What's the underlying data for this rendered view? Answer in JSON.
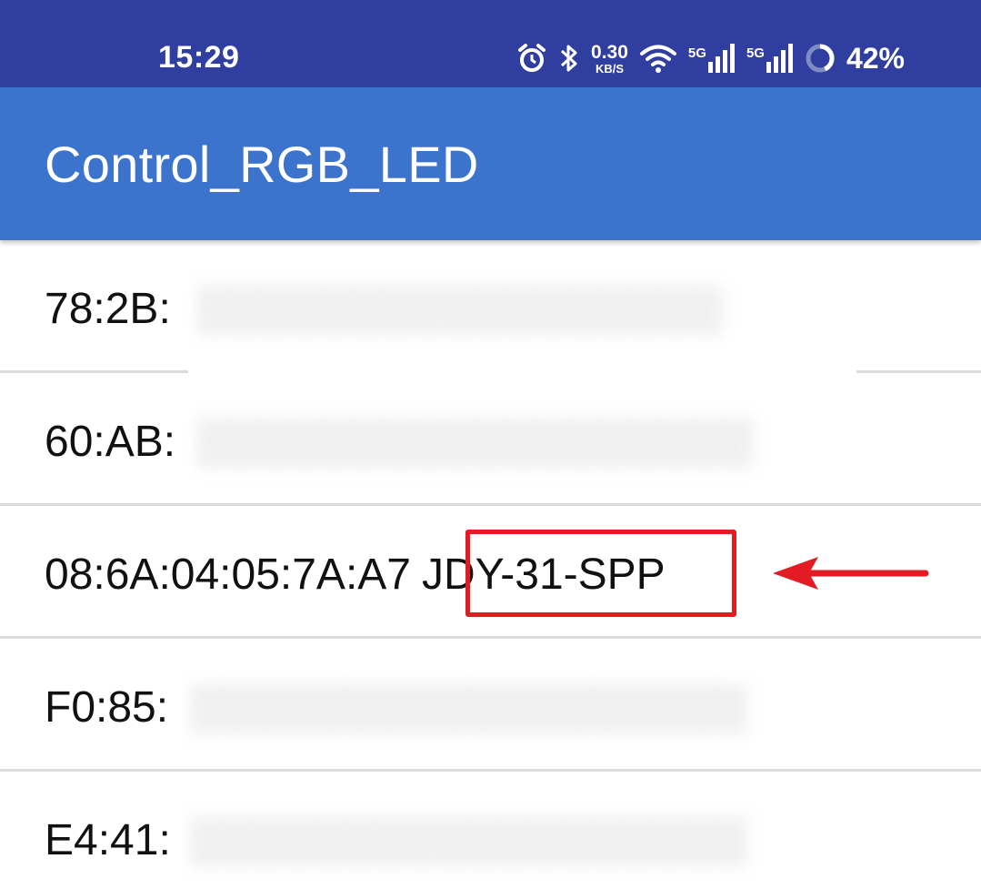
{
  "status_bar": {
    "time": "15:29",
    "net_speed_value": "0.30",
    "net_speed_unit": "KB/S",
    "sim1_type": "5G",
    "sim2_type": "5G",
    "battery": "42%",
    "icons": [
      "alarm-icon",
      "bluetooth-icon",
      "wifi-icon",
      "signal-icon",
      "signal-icon",
      "battery-ring-icon"
    ],
    "background_color": "#303f9f"
  },
  "app_bar": {
    "title": "Control_RGB_LED",
    "background_color": "#3b73cd"
  },
  "devices": [
    {
      "address": "78:2B:",
      "name": ""
    },
    {
      "address": "60:AB:",
      "name": ""
    },
    {
      "address": "08:6A:04:05:7A:A7",
      "name": "JDY-31-SPP"
    },
    {
      "address": "F0:85:",
      "name": ""
    },
    {
      "address": "E4:41:",
      "name": ""
    }
  ],
  "annotation": {
    "highlight_color": "#e31b23",
    "highlighted_device_index": 2,
    "arrow": "red-arrow-pointing-left"
  }
}
